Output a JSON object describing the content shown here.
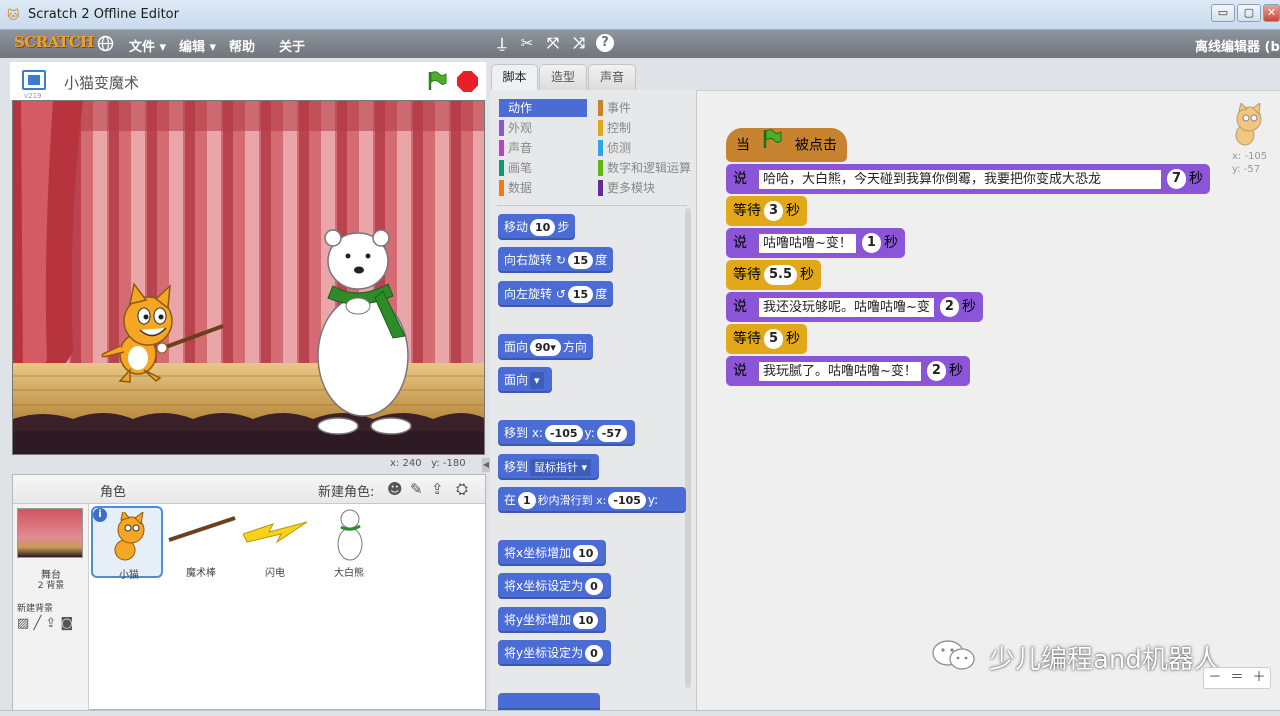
{
  "window": {
    "title": "Scratch 2 Offline Editor",
    "min": "▭",
    "max": "▢",
    "close": "✕"
  },
  "menu": {
    "logo": "SCRATCH",
    "file": "文件 ▾",
    "edit": "编辑 ▾",
    "help": "帮助",
    "about": "关于",
    "offline": "离线编辑器 (b"
  },
  "stage": {
    "project_name": "小猫变魔术",
    "version": "v219",
    "x_label": "x:",
    "x_value": "240",
    "y_label": "y:",
    "y_value": "-180"
  },
  "sprites": {
    "header": "角色",
    "new_sprite": "新建角色:",
    "stage_label": "舞台",
    "stage_backdrops": "2 背景",
    "new_backdrop": "新建背景",
    "items": [
      {
        "name": "小猫"
      },
      {
        "name": "魔术棒"
      },
      {
        "name": "闪电"
      },
      {
        "name": "大白熊"
      }
    ]
  },
  "tabs": [
    "脚本",
    "造型",
    "声音"
  ],
  "categories": {
    "left": [
      {
        "label": "动作",
        "color": "#4a6cd4"
      },
      {
        "label": "外观",
        "color": "#8a55d7"
      },
      {
        "label": "声音",
        "color": "#bb42c3"
      },
      {
        "label": "画笔",
        "color": "#0e9a6c"
      },
      {
        "label": "数据",
        "color": "#ee7d16"
      }
    ],
    "right": [
      {
        "label": "事件",
        "color": "#c88330"
      },
      {
        "label": "控制",
        "color": "#e1a91a"
      },
      {
        "label": "侦测",
        "color": "#2ca5e2"
      },
      {
        "label": "数字和逻辑运算",
        "color": "#5cb712"
      },
      {
        "label": "更多模块",
        "color": "#632d99"
      }
    ]
  },
  "palette": {
    "move": {
      "a": "移动",
      "n": "10",
      "b": "步"
    },
    "turn_right": {
      "a": "向右旋转",
      "icon": "↻",
      "n": "15",
      "b": "度"
    },
    "turn_left": {
      "a": "向左旋转",
      "icon": "↺",
      "n": "15",
      "b": "度"
    },
    "point_dir": {
      "a": "面向",
      "n": "90▾",
      "b": "方向"
    },
    "point_to": {
      "a": "面向",
      "d": "▾"
    },
    "goto_xy": {
      "a": "移到 x:",
      "x": "-105",
      "b": "y:",
      "y": "-57"
    },
    "goto": {
      "a": "移到",
      "d": "鼠标指针 ▾"
    },
    "glide": {
      "a": "在",
      "n": "1",
      "b": "秒内滑行到 x:",
      "x": "-105",
      "c": "y:"
    },
    "change_x": {
      "a": "将x坐标增加",
      "n": "10"
    },
    "set_x": {
      "a": "将x坐标设定为",
      "n": "0"
    },
    "change_y": {
      "a": "将y坐标增加",
      "n": "10"
    },
    "set_y": {
      "a": "将y坐标设定为",
      "n": "0"
    }
  },
  "script": {
    "hat": {
      "a": "当",
      "b": "被点击"
    },
    "say1": {
      "a": "说",
      "t": "哈哈，大白熊，今天碰到我算你倒霉，我要把你变成大恐龙",
      "n": "7",
      "b": "秒"
    },
    "wait1": {
      "a": "等待",
      "n": "3",
      "b": "秒"
    },
    "say2": {
      "a": "说",
      "t": "咕噜咕噜~变！",
      "n": "1",
      "b": "秒"
    },
    "wait2": {
      "a": "等待",
      "n": "5.5",
      "b": "秒"
    },
    "say3": {
      "a": "说",
      "t": "我还没玩够呢。咕噜咕噜~变",
      "n": "2",
      "b": "秒"
    },
    "wait3": {
      "a": "等待",
      "n": "5",
      "b": "秒"
    },
    "say4": {
      "a": "说",
      "t": "我玩腻了。咕噜咕噜~变！",
      "n": "2",
      "b": "秒"
    }
  },
  "sprite_info": {
    "x": "x: -105",
    "y": "y: -57"
  },
  "watermark": "少儿编程and机器人",
  "zoom": {
    "out": "－",
    "reset": "＝",
    "in": "＋"
  }
}
